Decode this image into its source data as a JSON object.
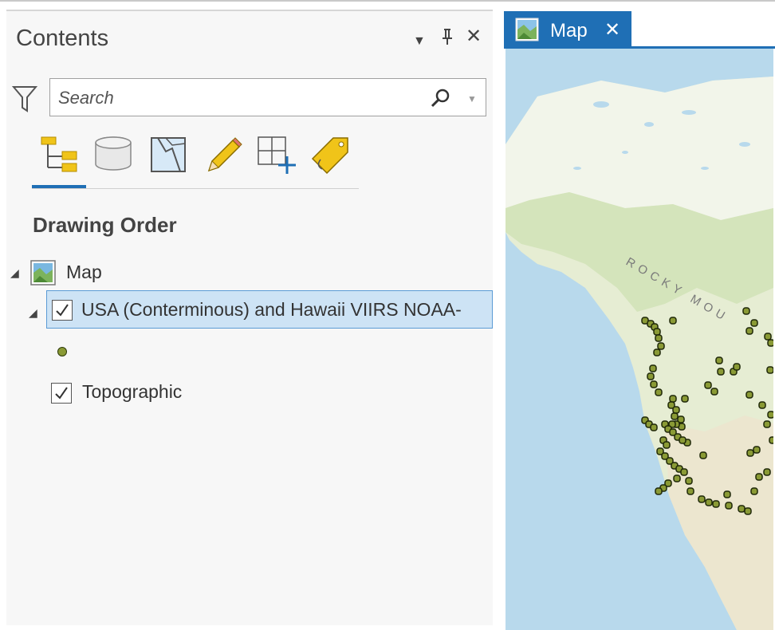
{
  "contents": {
    "title": "Contents",
    "search": {
      "placeholder": "Search",
      "value": ""
    },
    "views": [
      {
        "name": "list-by-drawing-order",
        "icon": "drawing-order-icon",
        "selected": true
      },
      {
        "name": "list-by-data-source",
        "icon": "database-icon"
      },
      {
        "name": "list-by-selection",
        "icon": "selection-icon"
      },
      {
        "name": "list-by-editing",
        "icon": "pencil-icon"
      },
      {
        "name": "list-by-snapping",
        "icon": "snapping-icon"
      },
      {
        "name": "list-by-labeling",
        "icon": "label-tag-icon"
      }
    ],
    "section_title": "Drawing Order",
    "tree": {
      "map_label": "Map",
      "layer_usa": "USA (Conterminous) and Hawaii VIIRS NOAA-",
      "layer_topo": "Topographic"
    }
  },
  "map_tab": {
    "label": "Map",
    "close": "✕"
  },
  "map": {
    "label": "ROCKY MOU",
    "colors": {
      "water": "#b8d9ec",
      "land": "#e6edd3",
      "snow": "#f2f5ea",
      "point_fill": "#8a9a35",
      "accent": "#1f6fb5"
    },
    "points_count_visible": 80
  }
}
